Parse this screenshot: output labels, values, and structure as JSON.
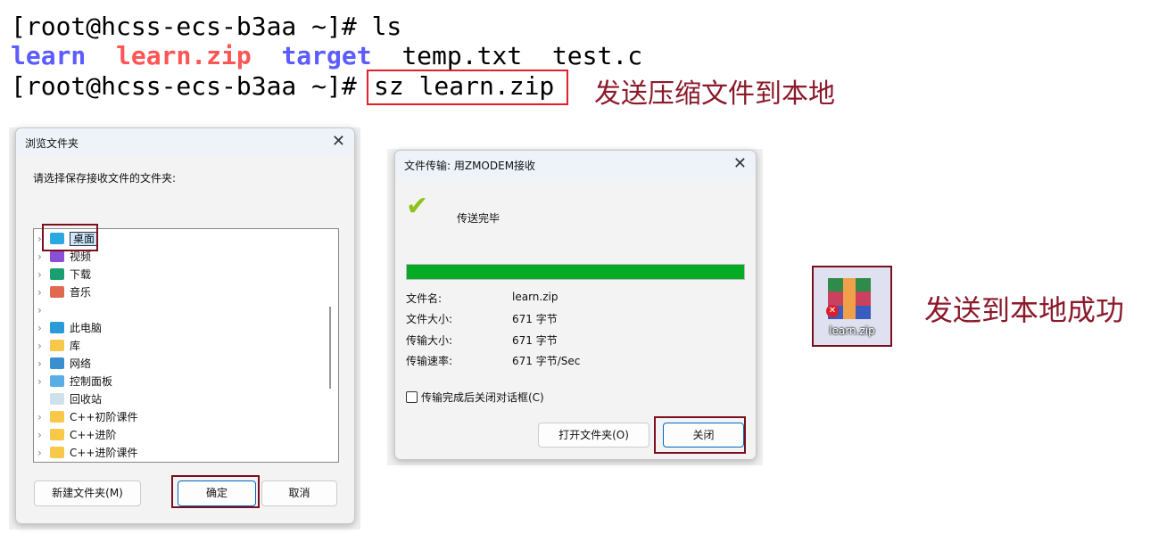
{
  "terminal": {
    "line1": "[root@hcss-ecs-b3aa ~]# ls",
    "ls_output": [
      {
        "name": "learn",
        "type": "dir"
      },
      {
        "name": "learn.zip",
        "type": "archive"
      },
      {
        "name": "target",
        "type": "dir"
      },
      {
        "name": "temp.txt",
        "type": "file"
      },
      {
        "name": "test.c",
        "type": "file"
      }
    ],
    "prompt": "[root@hcss-ecs-b3aa ~]#",
    "command": "sz learn.zip",
    "annotation": "发送压缩文件到本地"
  },
  "colors": {
    "dir": "#5c5cff",
    "archive": "#ff5555",
    "annotation": "#8b1a2b",
    "progress": "#06ab25"
  },
  "browse_dialog": {
    "title": "浏览文件夹",
    "prompt": "请选择保存接收文件的文件夹:",
    "tree": [
      {
        "label": "桌面",
        "icon": "desktop-icon",
        "selected": true
      },
      {
        "label": "视频",
        "icon": "video-icon"
      },
      {
        "label": "下载",
        "icon": "download-icon"
      },
      {
        "label": "音乐",
        "icon": "music-icon"
      },
      {
        "label": "",
        "icon": ""
      },
      {
        "label": "此电脑",
        "icon": "computer-icon"
      },
      {
        "label": "库",
        "icon": "folder-icon"
      },
      {
        "label": "网络",
        "icon": "network-icon"
      },
      {
        "label": "控制面板",
        "icon": "control-panel-icon"
      },
      {
        "label": "回收站",
        "icon": "recycle-bin-icon"
      },
      {
        "label": "C++初阶课件",
        "icon": "folder-icon"
      },
      {
        "label": "C++进阶",
        "icon": "folder-icon"
      },
      {
        "label": "C++进阶课件",
        "icon": "folder-icon"
      }
    ],
    "new_folder": "新建文件夹(M)",
    "ok": "确定",
    "cancel": "取消"
  },
  "transfer_dialog": {
    "title": "文件传输: 用ZMODEM接收",
    "status": "传送完毕",
    "progress_percent": 100,
    "fields": [
      {
        "label": "文件名:",
        "value": "learn.zip"
      },
      {
        "label": "文件大小:",
        "value": "671 字节"
      },
      {
        "label": "传输大小:",
        "value": "671 字节"
      },
      {
        "label": "传输速率:",
        "value": "671 字节/Sec"
      }
    ],
    "checkbox_label": "传输完成后关闭对话框(C)",
    "checkbox_checked": false,
    "open_folder": "打开文件夹(O)",
    "close": "关闭"
  },
  "desktop_file": {
    "name": "learn.zip",
    "annotation": "发送到本地成功"
  }
}
